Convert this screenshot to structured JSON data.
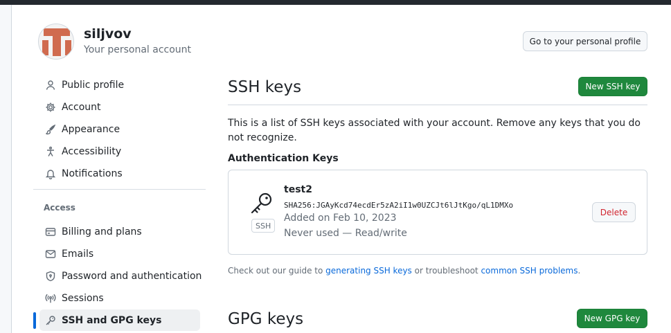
{
  "user": {
    "name": "siljvov",
    "subtitle": "Your personal account",
    "profile_button": "Go to your personal profile"
  },
  "sidebar": {
    "items": [
      {
        "label": "Public profile",
        "icon": "person-icon"
      },
      {
        "label": "Account",
        "icon": "gear-icon"
      },
      {
        "label": "Appearance",
        "icon": "paintbrush-icon"
      },
      {
        "label": "Accessibility",
        "icon": "accessibility-icon"
      },
      {
        "label": "Notifications",
        "icon": "bell-icon"
      }
    ],
    "access_heading": "Access",
    "access_items": [
      {
        "label": "Billing and plans",
        "icon": "credit-card-icon"
      },
      {
        "label": "Emails",
        "icon": "mail-icon"
      },
      {
        "label": "Password and authentication",
        "icon": "shield-lock-icon"
      },
      {
        "label": "Sessions",
        "icon": "broadcast-icon"
      },
      {
        "label": "SSH and GPG keys",
        "icon": "key-icon",
        "active": true
      }
    ]
  },
  "ssh": {
    "title": "SSH keys",
    "new_button": "New SSH key",
    "description": "This is a list of SSH keys associated with your account. Remove any keys that you do not recognize.",
    "auth_heading": "Authentication Keys",
    "key": {
      "title": "test2",
      "fingerprint": "SHA256:JGAyKcd74ecdEr5zA2iI1w0UZCJt6lJtKgo/qL1DMXo",
      "added": "Added on Feb 10, 2023",
      "usage": "Never used — Read/write",
      "badge": "SSH",
      "delete_button": "Delete"
    },
    "help": {
      "prefix": "Check out our guide to ",
      "link1": "generating SSH keys",
      "middle": " or troubleshoot ",
      "link2": "common SSH problems",
      "suffix": "."
    }
  },
  "gpg": {
    "title": "GPG keys",
    "new_button": "New GPG key"
  },
  "colors": {
    "primary_green": "#1f883d",
    "danger_red": "#d1242f",
    "link_blue": "#0969da",
    "avatar_orange": "#d06b4f"
  }
}
